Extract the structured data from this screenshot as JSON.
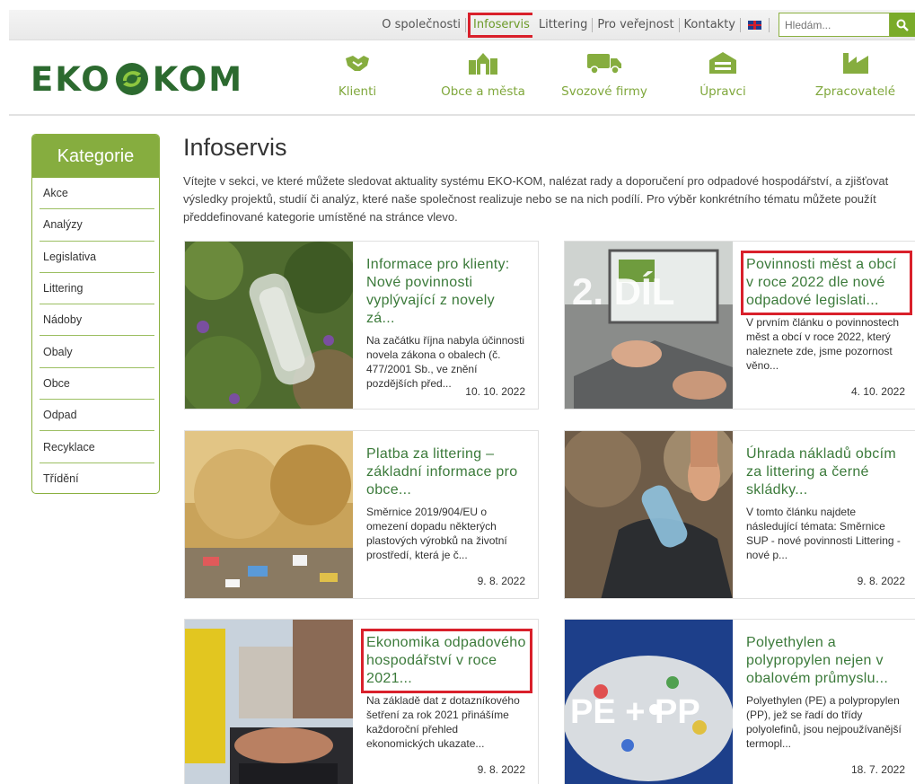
{
  "topnav": {
    "links": [
      "O společnosti",
      "Infoservis",
      "Littering",
      "Pro veřejnost",
      "Kontakty"
    ],
    "active": "Infoservis",
    "lang_flag": "uk-flag-icon",
    "search_placeholder": "Hledám..."
  },
  "logo": {
    "text_left": "EKO",
    "text_right": "KOM"
  },
  "mainnav": [
    {
      "label": "Klienti",
      "icon": "handshake-icon"
    },
    {
      "label": "Obce a města",
      "icon": "city-icon"
    },
    {
      "label": "Svozové firmy",
      "icon": "truck-icon"
    },
    {
      "label": "Úpravci",
      "icon": "sorting-icon"
    },
    {
      "label": "Zpracovatelé",
      "icon": "factory-icon"
    }
  ],
  "sidebar": {
    "title": "Kategorie",
    "items": [
      "Akce",
      "Analýzy",
      "Legislativa",
      "Littering",
      "Nádoby",
      "Obaly",
      "Obce",
      "Odpad",
      "Recyklace",
      "Třídění"
    ]
  },
  "page": {
    "title": "Infoservis",
    "intro": "Vítejte v sekci, ve které můžete sledovat aktuality systému EKO-KOM, nalézat rady a doporučení pro odpadové hospodářství, a zjišťovat výsledky projektů, studií či analýz, které naše společnost realizuje nebo se na nich podílí. Pro výběr konkrétního tématu můžete použít předdefinované kategorie umístěné na stránce vlevo."
  },
  "articles": [
    {
      "title": "Informace pro klienty: Nové povinnosti vyplývající z novely zá...",
      "excerpt": "Na začátku října nabyla účinnosti novela zákona o obalech (č. 477/2001 Sb., ve znění pozdějších před...",
      "date": "10. 10. 2022",
      "image": "plastic-bottle-in-grass"
    },
    {
      "title": "Povinnosti měst a obcí v roce 2022 dle nové odpadové legislati...",
      "excerpt": "V prvním článku o povinnostech měst a obcí v roce 2022, který naleznete zde, jsme pozornost věno...",
      "date": "4. 10. 2022",
      "image": "laptop-2-dil",
      "image_text": "2. DÍL"
    },
    {
      "title": "Platba za littering – základní informace pro obce...",
      "excerpt": "Směrnice 2019/904/EU  o omezení dopadu některých plastových výrobků na životní prostředí, která je č...",
      "date": "9. 8. 2022",
      "image": "litter-in-dry-grass"
    },
    {
      "title": "Úhrada nákladů obcím za littering a černé skládky...",
      "excerpt": "V tomto článku najdete následující témata: Směrnice SUP - nové povinnosti Littering - nové p...",
      "date": "9. 8. 2022",
      "image": "hand-picking-bottle"
    },
    {
      "title": "Ekonomika odpadového hospodářství v roce 2021...",
      "excerpt": "Na základě dat z dotazníkového šetření za rok 2021 přinášíme každoroční přehled ekonomických ukazate...",
      "date": "9. 8. 2022",
      "image": "calculator-and-bins"
    },
    {
      "title": "Polyethylen a polypropylen nejen v obalovém průmyslu...",
      "excerpt": "Polyethylen (PE) a polypropylen (PP), jež se řadí do třídy polyolefinů, jsou nejpoužívanější termopl...",
      "date": "18. 7. 2022",
      "image": "plastic-flakes-pe-pp",
      "image_text": "PE + PP"
    }
  ],
  "colors": {
    "brand_green": "#86ad3f",
    "link_green": "#3b7a3a",
    "highlight_red": "#d9202b"
  }
}
